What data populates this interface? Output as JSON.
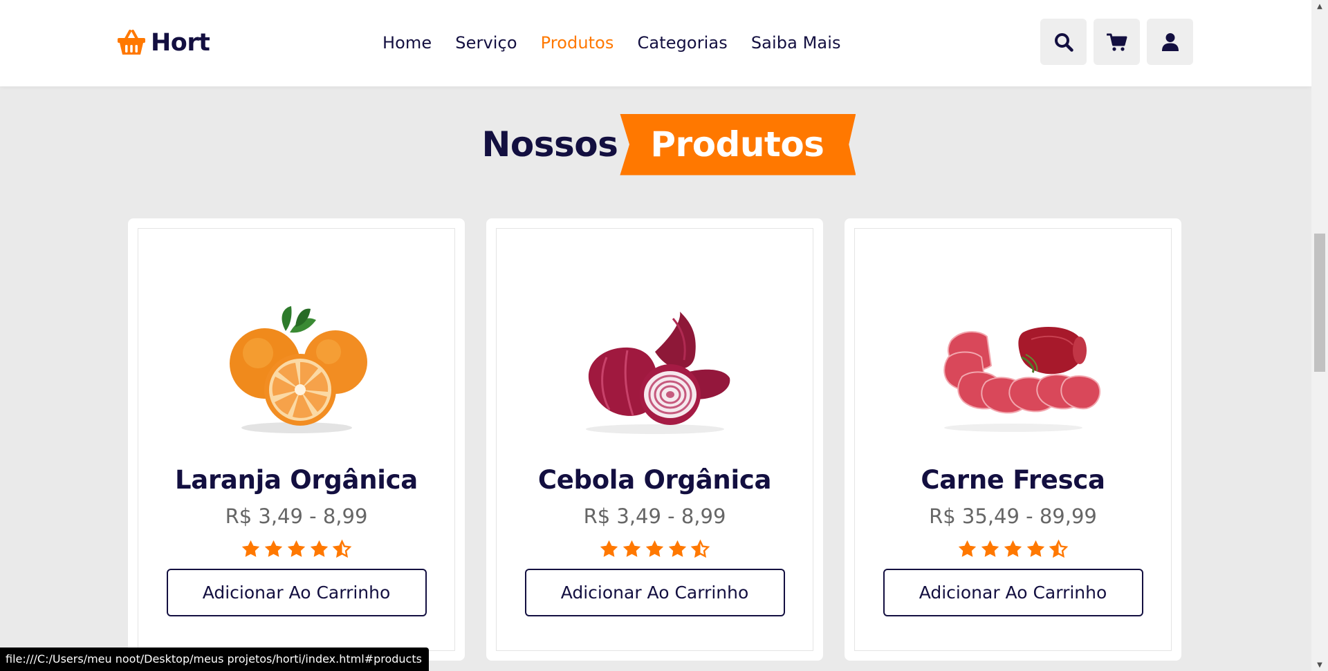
{
  "header": {
    "logo_text": "Hort",
    "logo_icon": "shopping-basket-icon",
    "nav": [
      {
        "label": "Home",
        "active": false
      },
      {
        "label": "Serviço",
        "active": false
      },
      {
        "label": "Produtos",
        "active": true
      },
      {
        "label": "Categorias",
        "active": false
      },
      {
        "label": "Saiba Mais",
        "active": false
      }
    ],
    "icons": [
      "search-icon",
      "cart-icon",
      "user-icon"
    ]
  },
  "heading": {
    "plain": "Nossos",
    "highlight": "Produtos"
  },
  "products": [
    {
      "title": "Laranja Orgânica",
      "price": "R$ 3,49 - 8,99",
      "rating": 4.5,
      "button": "Adicionar Ao Carrinho",
      "image": "orange-image"
    },
    {
      "title": "Cebola Orgânica",
      "price": "R$ 3,49 - 8,99",
      "rating": 4.5,
      "button": "Adicionar Ao Carrinho",
      "image": "onion-image"
    },
    {
      "title": "Carne Fresca",
      "price": "R$ 35,49 - 89,99",
      "rating": 4.5,
      "button": "Adicionar Ao Carrinho",
      "image": "meat-image"
    }
  ],
  "status_bar": {
    "url": "file:///C:/Users/meu noot/Desktop/meus projetos/horti/index.html#products"
  },
  "colors": {
    "accent": "#ff7800",
    "dark": "#130f40",
    "background": "#eaeaea",
    "price": "#666666"
  }
}
